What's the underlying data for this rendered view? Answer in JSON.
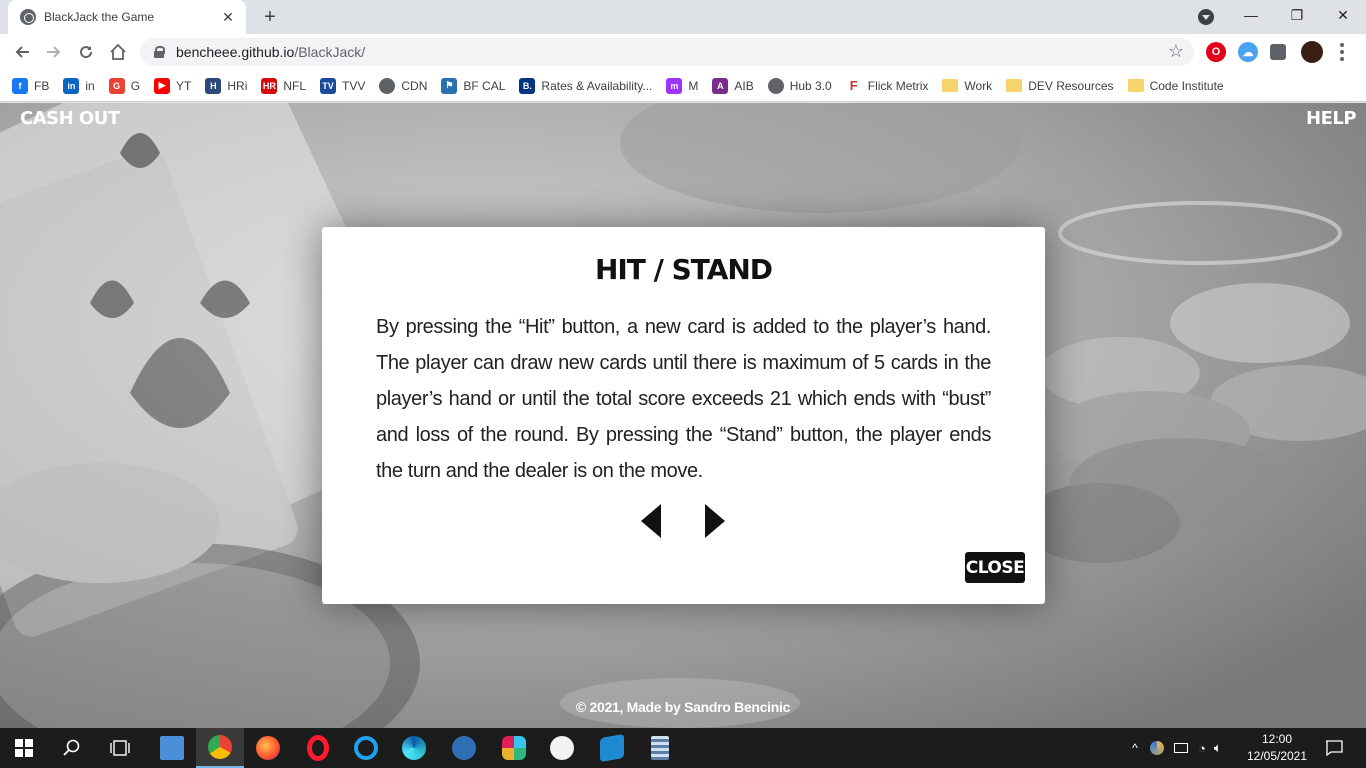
{
  "browser": {
    "tab_title": "BlackJack the Game",
    "tab_close": "✕",
    "new_tab": "+",
    "url_host": "bencheee.github.io",
    "url_path": "/BlackJack/",
    "window_controls": {
      "minimize": "—",
      "restore": "❐",
      "close": "✕"
    }
  },
  "bookmarks": [
    {
      "label": "FB",
      "icon": "facebook-icon",
      "color": "#1877f2",
      "glyph": "f"
    },
    {
      "label": "in",
      "icon": "linkedin-icon",
      "color": "#0a66c2",
      "glyph": "in"
    },
    {
      "label": "G",
      "icon": "google-icon",
      "color": "#ea4335",
      "glyph": "G"
    },
    {
      "label": "YT",
      "icon": "youtube-icon",
      "color": "#ff0000",
      "glyph": "▶"
    },
    {
      "label": "HRi",
      "icon": "hri-icon",
      "color": "#2b4a7a",
      "glyph": "H"
    },
    {
      "label": "NFL",
      "icon": "nfl-icon",
      "color": "#d50a0a",
      "glyph": "HR"
    },
    {
      "label": "TVV",
      "icon": "tvv-icon",
      "color": "#1a4b9b",
      "glyph": "TV"
    },
    {
      "label": "CDN",
      "icon": "globe-icon",
      "color": "#5f6368",
      "glyph": ""
    },
    {
      "label": "BF CAL",
      "icon": "runner-icon",
      "color": "#2a6fb0",
      "glyph": "⚑"
    },
    {
      "label": "Rates & Availability...",
      "icon": "booking-icon",
      "color": "#003580",
      "glyph": "B."
    },
    {
      "label": "M",
      "icon": "messenger-icon",
      "color": "#a033ff",
      "glyph": "m"
    },
    {
      "label": "AIB",
      "icon": "aib-icon",
      "color": "#7a2d8c",
      "glyph": "A"
    },
    {
      "label": "Hub 3.0",
      "icon": "globe-icon",
      "color": "#5f6368",
      "glyph": ""
    },
    {
      "label": "Flick Metrix",
      "icon": "flick-icon",
      "color": "#ffffff",
      "glyph": "F"
    },
    {
      "label": "Work",
      "icon": "folder-icon",
      "color": "#f6d36b",
      "glyph": ""
    },
    {
      "label": "DEV Resources",
      "icon": "folder-icon",
      "color": "#f6d36b",
      "glyph": ""
    },
    {
      "label": "Code Institute",
      "icon": "folder-icon",
      "color": "#f6d36b",
      "glyph": ""
    }
  ],
  "page": {
    "cash_out": "CASH OUT",
    "help": "HELP",
    "footer": "© 2021, Made by Sandro Bencinic"
  },
  "modal": {
    "title": "HIT / STAND",
    "body": "By pressing the “Hit” button, a new card is added to the player’s hand. The player can draw new cards until there is maximum of 5 cards in the player’s hand or until the total score exceeds 21 which ends with “bust” and loss of the round. By pressing the “Stand” button, the player ends the turn and the dealer is on the move.",
    "close": "CLOSE"
  },
  "taskbar": {
    "time": "12:00",
    "date": "12/05/2021"
  }
}
